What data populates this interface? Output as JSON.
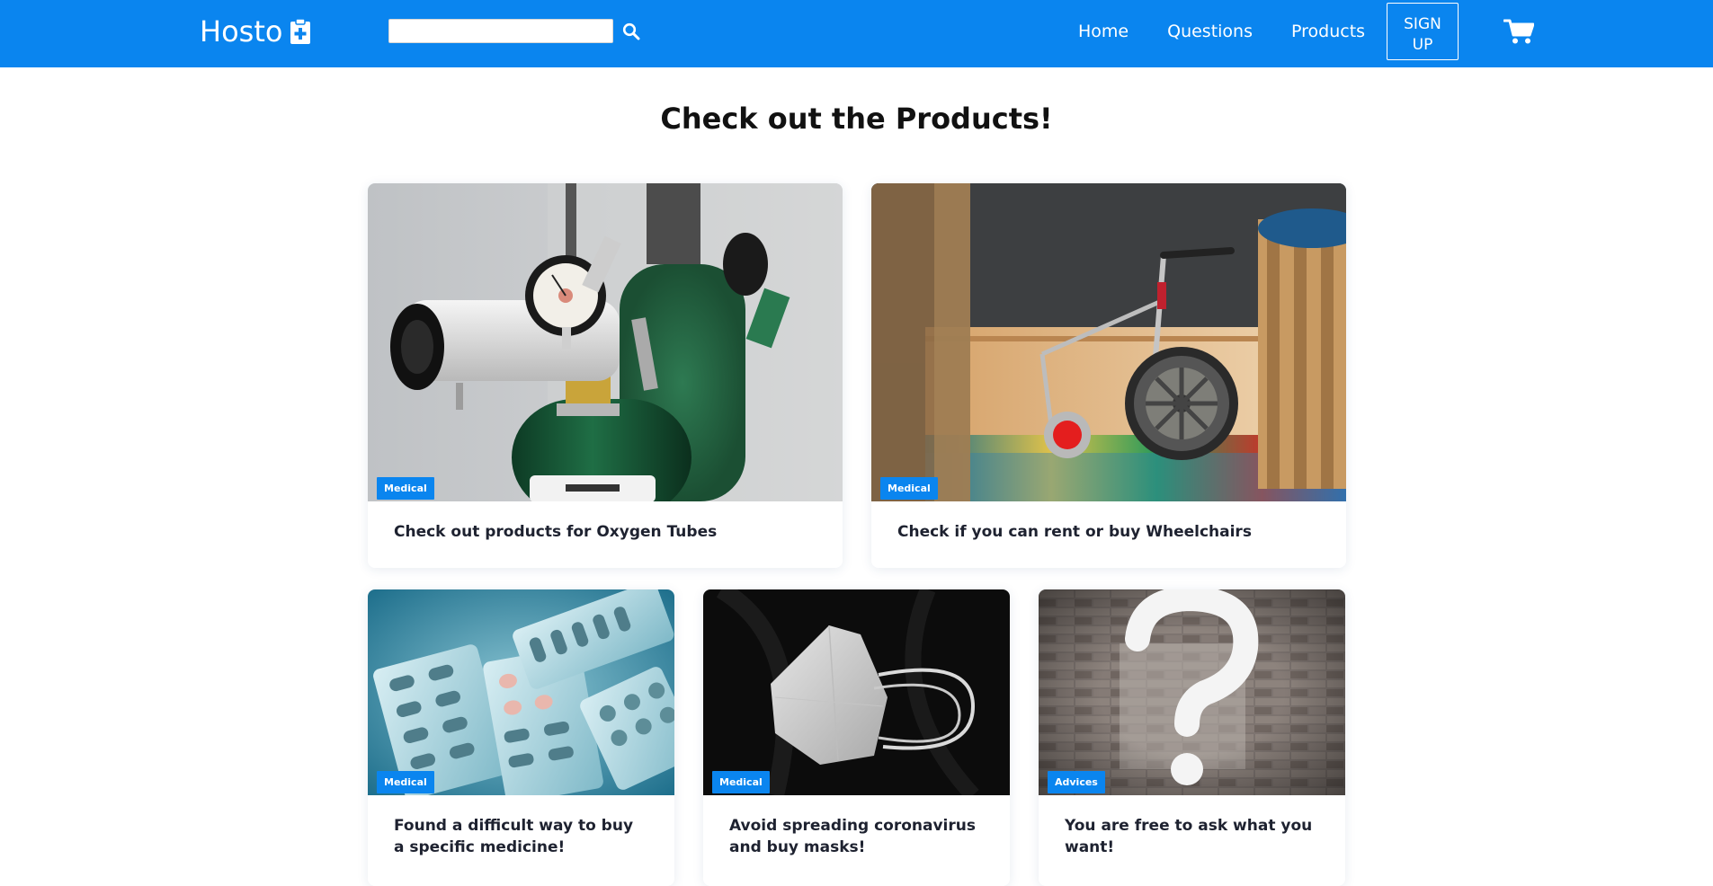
{
  "navbar": {
    "brand": "Hosto",
    "search_placeholder": "",
    "links": [
      "Home",
      "Questions",
      "Products"
    ],
    "signup_label": "SIGN\nUP",
    "bg_color": "#0a85ef"
  },
  "icons": {
    "brand": "medical-clipboard-icon",
    "search": "search-icon",
    "cart": "shopping-cart-icon"
  },
  "page": {
    "title": "Check out the Products!"
  },
  "cards": [
    {
      "badge": "Medical",
      "title": "Check out products for Oxygen Tubes",
      "image": "oxygen-cylinder-regulator"
    },
    {
      "badge": "Medical",
      "title": "Check if you can rent or buy Wheelchairs",
      "image": "walker-wheelchair"
    },
    {
      "badge": "Medical",
      "title": "Found a difficult way to buy a specific medicine!",
      "image": "pill-blister-packs"
    },
    {
      "badge": "Medical",
      "title": "Avoid spreading coronavirus and buy masks!",
      "image": "face-mask"
    },
    {
      "badge": "Advices",
      "title": "You are free to ask what you want!",
      "image": "question-mark-wall"
    }
  ]
}
